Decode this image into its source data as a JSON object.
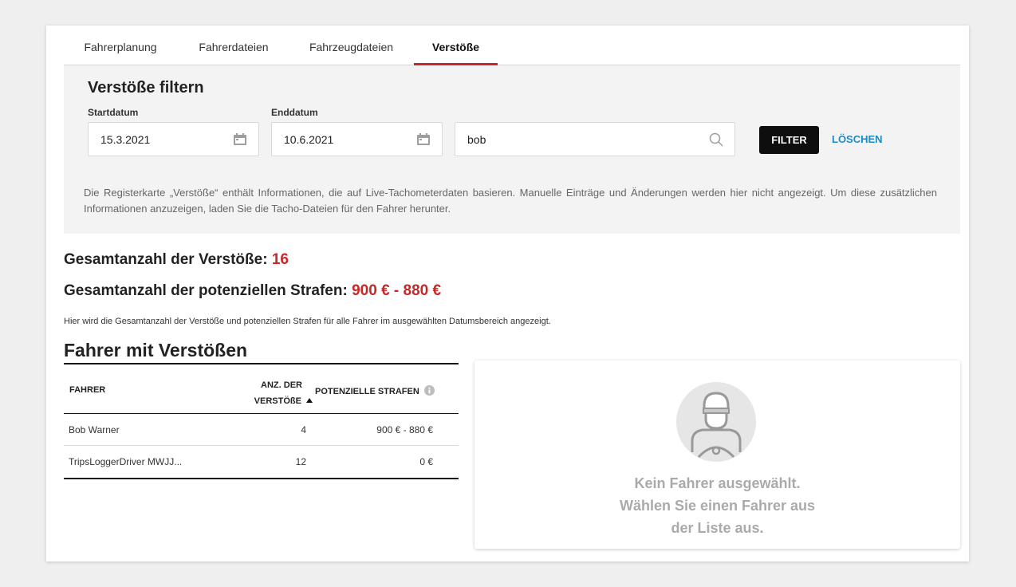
{
  "tabs": [
    {
      "label": "Fahrerplanung",
      "active": false
    },
    {
      "label": "Fahrerdateien",
      "active": false
    },
    {
      "label": "Fahrzeugdateien",
      "active": false
    },
    {
      "label": "Verstöße",
      "active": true
    }
  ],
  "filter": {
    "title": "Verstöße filtern",
    "start_label": "Startdatum",
    "start_value": "15.3.2021",
    "end_label": "Enddatum",
    "end_value": "10.6.2021",
    "search_value": "bob",
    "filter_button": "FILTER",
    "clear_button": "LÖSCHEN",
    "info": "Die Registerkarte „Verstöße“ enthält Informationen, die auf Live-Tachometerdaten basieren. Manuelle Einträge und Änderungen werden hier nicht angezeigt. Um diese zusätzlichen Informationen anzuzeigen, laden Sie die Tacho-Dateien für den Fahrer herunter."
  },
  "summary": {
    "total_label": "Gesamtanzahl der Verstöße:",
    "total_value": "16",
    "fines_label": "Gesamtanzahl der potenziellen Strafen:",
    "fines_value": "900 € - 880 €",
    "note": "Hier wird die Gesamtanzahl der Verstöße und potenziellen Strafen für alle Fahrer im ausgewählten Datumsbereich angezeigt."
  },
  "drivers": {
    "title": "Fahrer mit Verstößen",
    "columns": {
      "driver": "FAHRER",
      "count_line1": "ANZ. DER",
      "count_line2": "VERSTÖßE",
      "fines": "POTENZIELLE STRAFEN"
    },
    "rows": [
      {
        "name": "Bob Warner",
        "count": "4",
        "fines": "900 € - 880 €"
      },
      {
        "name": "TripsLoggerDriver MWJJ...",
        "count": "12",
        "fines": "0 €"
      }
    ]
  },
  "empty_state": {
    "line1": "Kein Fahrer ausgewählt.",
    "line2": "Wählen Sie einen Fahrer aus",
    "line3": "der Liste aus."
  },
  "colors": {
    "accent": "#c62828",
    "link": "#1f8ac6",
    "button": "#0e0e0e"
  },
  "icons": [
    "calendar-icon",
    "search-icon",
    "sort-ascending-icon",
    "info-icon",
    "driver-avatar-icon"
  ]
}
